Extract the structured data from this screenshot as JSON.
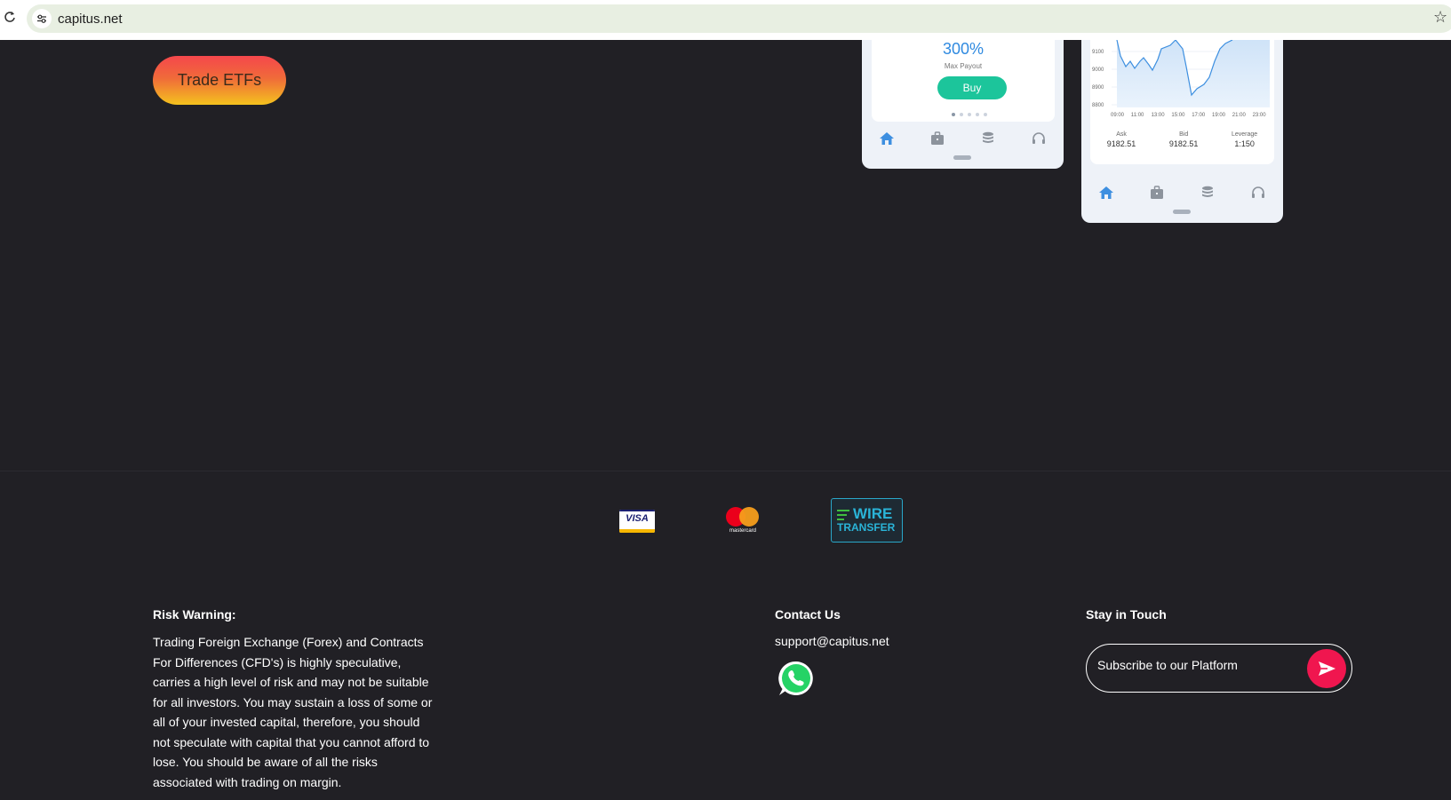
{
  "browser": {
    "url": "capitus.net",
    "icons": [
      "reload-icon",
      "site-info-icon",
      "bookmark-star-icon"
    ]
  },
  "hero": {
    "cta_label": "Trade ETFs",
    "accent_gradient": [
      "#f5474c",
      "#f4c21e"
    ]
  },
  "phone1": {
    "payout_value": "300%",
    "payout_label": "Max Payout",
    "buy_label": "Buy",
    "buy_color": "#1cc59b",
    "nav_icons": [
      "home-icon",
      "briefcase-icon",
      "database-icon",
      "headset-icon"
    ]
  },
  "phone2": {
    "y_ticks": [
      "9100",
      "9000",
      "8900",
      "8800"
    ],
    "x_ticks": [
      "09:00",
      "11:00",
      "13:00",
      "15:00",
      "17:00",
      "19:00",
      "21:00",
      "23:00"
    ],
    "ask_label": "Ask",
    "ask_value": "9182.51",
    "bid_label": "Bid",
    "bid_value": "9182.51",
    "leverage_label": "Leverage",
    "leverage_value": "1:150",
    "line_color": "#3d8fe0",
    "nav_icons": [
      "home-icon",
      "briefcase-icon",
      "database-icon",
      "headset-icon"
    ]
  },
  "payments": {
    "visa": "VISA",
    "mastercard": "mastercard",
    "wire_line1": "WIRE",
    "wire_line2": "TRANSFER"
  },
  "footer": {
    "risk_title": "Risk Warning:",
    "risk_text": "Trading Foreign Exchange (Forex) and Contracts For Differences (CFD's) is highly speculative, carries a high level of risk and may not be suitable for all investors. You may sustain a loss of some or all of your invested capital, therefore, you should not speculate with capital that you cannot afford to lose. You should be aware of all the risks associated with trading on margin.",
    "contact_title": "Contact Us",
    "contact_email": "support@capitus.net",
    "touch_title": "Stay in Touch",
    "subscribe_placeholder": "Subscribe to our Platform",
    "send_color": "#f0164f"
  }
}
